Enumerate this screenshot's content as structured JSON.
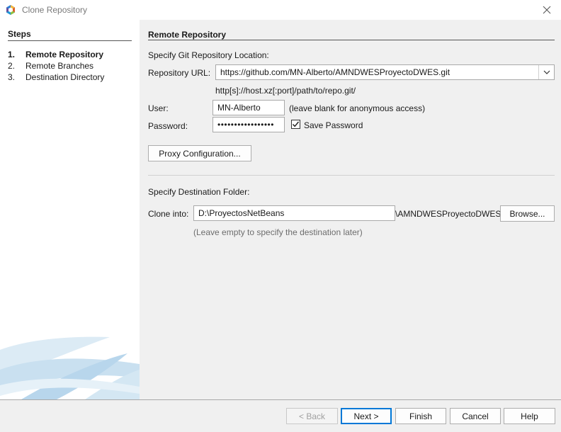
{
  "window": {
    "title": "Clone Repository",
    "close_icon": "close-icon"
  },
  "steps": {
    "title": "Steps",
    "items": [
      {
        "num": "1.",
        "label": "Remote Repository",
        "active": true
      },
      {
        "num": "2.",
        "label": "Remote Branches",
        "active": false
      },
      {
        "num": "3.",
        "label": "Destination Directory",
        "active": false
      }
    ]
  },
  "main": {
    "section_title": "Remote Repository",
    "location_heading": "Specify Git Repository Location:",
    "repo_url_label": "Repository URL:",
    "repo_url_value": "https://github.com/MN-Alberto/AMNDWESProyectoDWES.git",
    "url_format_hint": "http[s]://host.xz[:port]/path/to/repo.git/",
    "user_label": "User:",
    "user_value": "MN-Alberto",
    "user_hint": "(leave blank for anonymous access)",
    "password_label": "Password:",
    "password_value": "•••••••••••••••••",
    "save_password_label": "Save Password",
    "save_password_checked": true,
    "proxy_button": "Proxy Configuration...",
    "destination_heading": "Specify Destination Folder:",
    "clone_into_label": "Clone into:",
    "clone_into_value": "D:\\ProyectosNetBeans",
    "clone_suffix": "\\AMNDWESProyectoDWES",
    "browse_button": "Browse...",
    "destination_hint": "(Leave empty to specify the destination later)"
  },
  "footer": {
    "back": "< Back",
    "next": "Next >",
    "finish": "Finish",
    "cancel": "Cancel",
    "help": "Help"
  },
  "colors": {
    "accent": "#0078d7",
    "panel_bg": "#ffffff",
    "dialog_bg": "#f0f0f0"
  }
}
